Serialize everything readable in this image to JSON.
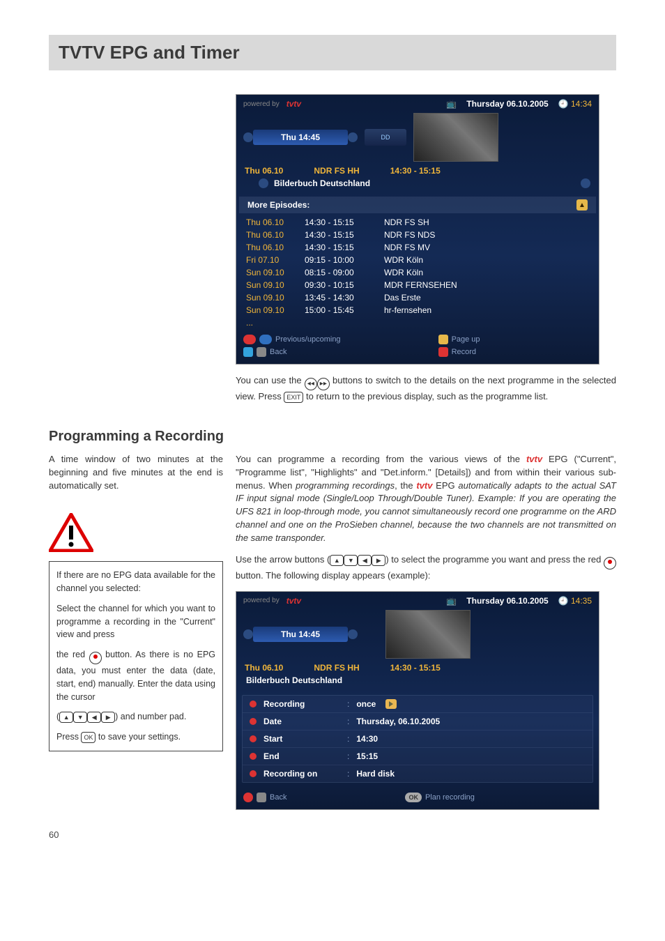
{
  "page": {
    "title": "TVTV EPG and Timer",
    "number": "60"
  },
  "screenshot1": {
    "powered": "powered by",
    "logo": "tvtv",
    "date_icon": "📺",
    "date": "Thursday 06.10.2005",
    "clock_icon": "🕘",
    "clock": "14:34",
    "tab": "Thu 14:45",
    "dd": "DD",
    "row_date": "Thu 06.10",
    "row_channel": "NDR FS HH",
    "row_time": "14:30 - 15:15",
    "row_title": "Bilderbuch Deutschland",
    "more": "More Episodes:",
    "episodes": [
      {
        "d": "Thu 06.10",
        "t": "14:30 - 15:15",
        "c": "NDR FS SH"
      },
      {
        "d": "Thu 06.10",
        "t": "14:30 - 15:15",
        "c": "NDR FS NDS"
      },
      {
        "d": "Thu 06.10",
        "t": "14:30 - 15:15",
        "c": "NDR FS MV"
      },
      {
        "d": "Fri   07.10",
        "t": "09:15 - 10:00",
        "c": "WDR Köln"
      },
      {
        "d": "Sun 09.10",
        "t": "08:15 - 09:00",
        "c": "WDR Köln"
      },
      {
        "d": "Sun 09.10",
        "t": "09:30 - 10:15",
        "c": "MDR FERNSEHEN"
      },
      {
        "d": "Sun 09.10",
        "t": "13:45 - 14:30",
        "c": "Das Erste"
      },
      {
        "d": "Sun 09.10",
        "t": "15:00 - 15:45",
        "c": "hr-fernsehen"
      }
    ],
    "foot_prev": "Previous/upcoming",
    "foot_back": "Back",
    "foot_pageup": "Page up",
    "foot_record": "Record"
  },
  "body1": {
    "p1a": "You can use the ",
    "p1b": " buttons to switch to the details on the next programme in the selected view. Press ",
    "p1c": " to return to the previous display, such as the programme list."
  },
  "section": "Programming a Recording",
  "leftcol": {
    "p1": "A time window of two minutes at the beginning and five minutes at the end is automatically set.",
    "box": {
      "p1": "If there are no EPG data available for the channel you selected:",
      "p2": "Select the channel for which you want to programme a recording in the \"Current\" view and press",
      "p3a": "the red ",
      "p3b": " button. As there is no EPG data, you must enter the data (date, start, end) manually. Enter the data using the cursor",
      "p4a": "(",
      "p4b": ") and number pad.",
      "p5a": "Press ",
      "p5b": " to save your settings."
    }
  },
  "rightcol": {
    "p1a": "You can programme a recording from the various views of the ",
    "p1b": " EPG (\"Current\", \"Programme list\", \"Highlights\" and \"Det.inform.\" [Details]) and from within their various sub-menus. When ",
    "p1c": "programming recordings",
    "p1d": ", the ",
    "p1e": " EPG ",
    "p1f": "automatically adapts to the actual SAT IF input signal mode (Single/Loop Through/Double Tuner). Example: If you are operating the UFS 821 in loop-through mode, you cannot simultaneously record one programme on the ARD channel and one on the ProSieben channel, because the two channels are not transmitted on the same transponder.",
    "p2a": "Use the arrow buttons (",
    "p2b": ") to select the programme you want and press the red ",
    "p2c": " button. The following display appears (example):"
  },
  "screenshot2": {
    "powered": "powered by",
    "logo": "tvtv",
    "date": "Thursday 06.10.2005",
    "clock": "14:35",
    "tab": "Thu 14:45",
    "row_date": "Thu 06.10",
    "row_channel": "NDR FS HH",
    "row_time": "14:30 - 15:15",
    "row_title": "Bilderbuch Deutschland",
    "rows": [
      {
        "lab": "Recording",
        "val": "once"
      },
      {
        "lab": "Date",
        "val": "Thursday, 06.10.2005"
      },
      {
        "lab": "Start",
        "val": "14:30"
      },
      {
        "lab": "End",
        "val": "15:15"
      },
      {
        "lab": "Recording on",
        "val": "Hard disk"
      }
    ],
    "foot_back": "Back",
    "foot_plan": "Plan recording",
    "ok": "OK"
  }
}
